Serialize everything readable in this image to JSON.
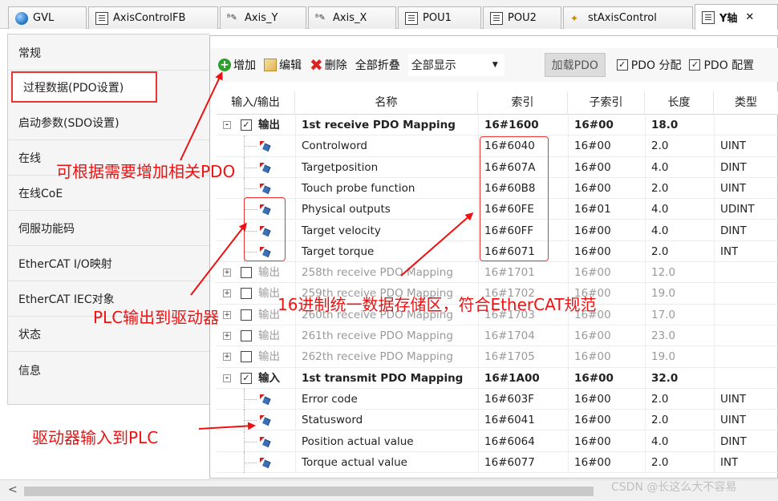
{
  "tabs": [
    {
      "label": "GVL",
      "icon": "globe-icon"
    },
    {
      "label": "AxisControlFB",
      "icon": "document-icon"
    },
    {
      "label": "Axis_Y",
      "icon": "variable-icon"
    },
    {
      "label": "Axis_X",
      "icon": "variable-icon"
    },
    {
      "label": "POU1",
      "icon": "document-icon"
    },
    {
      "label": "POU2",
      "icon": "document-icon"
    },
    {
      "label": "stAxisControl",
      "icon": "struct-icon"
    },
    {
      "label": "Y轴",
      "icon": "axis-icon",
      "close": "✕"
    }
  ],
  "sidebar": {
    "items": [
      {
        "label": "常规"
      },
      {
        "label": "过程数据(PDO设置)"
      },
      {
        "label": "启动参数(SDO设置)"
      },
      {
        "label": "在线"
      },
      {
        "label": "在线CoE"
      },
      {
        "label": "伺服功能码"
      },
      {
        "label": "EtherCAT I/O映射"
      },
      {
        "label": "EtherCAT IEC对象"
      },
      {
        "label": "状态"
      },
      {
        "label": "信息"
      }
    ]
  },
  "toolbar": {
    "add_label": "增加",
    "edit_label": "编辑",
    "delete_label": "删除",
    "collapse_label": "全部折叠",
    "display_value": "全部显示",
    "load_pdo_label": "加载PDO",
    "pdo_assign_label": "PDO 分配",
    "pdo_config_label": "PDO 配置"
  },
  "table": {
    "headers": [
      "输入/输出",
      "名称",
      "索引",
      "子索引",
      "长度",
      "类型"
    ],
    "rows": [
      {
        "kind": "group",
        "expander": "-",
        "checked": true,
        "io": "输出",
        "name": "1st receive PDO Mapping",
        "index": "16#1600",
        "subindex": "16#00",
        "length": "18.0",
        "type": ""
      },
      {
        "kind": "entry",
        "name": "Controlword",
        "index": "16#6040",
        "subindex": "16#00",
        "length": "2.0",
        "type": "UINT"
      },
      {
        "kind": "entry",
        "name": "Targetposition",
        "index": "16#607A",
        "subindex": "16#00",
        "length": "4.0",
        "type": "DINT"
      },
      {
        "kind": "entry",
        "name": "Touch probe function",
        "index": "16#60B8",
        "subindex": "16#00",
        "length": "2.0",
        "type": "UINT"
      },
      {
        "kind": "entry",
        "name": "Physical outputs",
        "index": "16#60FE",
        "subindex": "16#01",
        "length": "4.0",
        "type": "UDINT"
      },
      {
        "kind": "entry",
        "name": "Target velocity",
        "index": "16#60FF",
        "subindex": "16#00",
        "length": "4.0",
        "type": "DINT"
      },
      {
        "kind": "entry",
        "name": "Target torque",
        "index": "16#6071",
        "subindex": "16#00",
        "length": "2.0",
        "type": "INT"
      },
      {
        "kind": "disabled",
        "expander": "+",
        "checked": false,
        "io": "输出",
        "name": "258th receive PDO Mapping",
        "index": "16#1701",
        "subindex": "16#00",
        "length": "12.0",
        "type": ""
      },
      {
        "kind": "disabled",
        "expander": "+",
        "checked": false,
        "io": "输出",
        "name": "259th receive PDO Mapping",
        "index": "16#1702",
        "subindex": "16#00",
        "length": "19.0",
        "type": ""
      },
      {
        "kind": "disabled",
        "expander": "+",
        "checked": false,
        "io": "输出",
        "name": "260th receive PDO Mapping",
        "index": "16#1703",
        "subindex": "16#00",
        "length": "17.0",
        "type": ""
      },
      {
        "kind": "disabled",
        "expander": "+",
        "checked": false,
        "io": "输出",
        "name": "261th receive PDO Mapping",
        "index": "16#1704",
        "subindex": "16#00",
        "length": "23.0",
        "type": ""
      },
      {
        "kind": "disabled",
        "expander": "+",
        "checked": false,
        "io": "输出",
        "name": "262th receive PDO Mapping",
        "index": "16#1705",
        "subindex": "16#00",
        "length": "19.0",
        "type": ""
      },
      {
        "kind": "group",
        "expander": "-",
        "checked": true,
        "io": "输入",
        "name": "1st transmit PDO Mapping",
        "index": "16#1A00",
        "subindex": "16#00",
        "length": "32.0",
        "type": ""
      },
      {
        "kind": "entry",
        "name": "Error code",
        "index": "16#603F",
        "subindex": "16#00",
        "length": "2.0",
        "type": "UINT"
      },
      {
        "kind": "entry",
        "name": "Statusword",
        "index": "16#6041",
        "subindex": "16#00",
        "length": "2.0",
        "type": "UINT"
      },
      {
        "kind": "entry",
        "name": "Position actual value",
        "index": "16#6064",
        "subindex": "16#00",
        "length": "4.0",
        "type": "DINT"
      },
      {
        "kind": "entry",
        "name": "Torque actual value",
        "index": "16#6077",
        "subindex": "16#00",
        "length": "2.0",
        "type": "INT"
      }
    ]
  },
  "annotations": {
    "add_pdo": "可根据需要增加相关PDO",
    "hex_storage": "16进制统一数据存储区，符合EtherCAT规范",
    "plc_to_drive": "PLC输出到驱动器",
    "drive_to_plc": "驱动器输入到PLC"
  },
  "scrollbar": {
    "left_arrow": "<"
  },
  "watermark": "CSDN @长这么大不容易",
  "colors": {
    "annotation": "#e11111",
    "add_icon": "#2e9e2e",
    "delete_icon": "#d22222"
  }
}
